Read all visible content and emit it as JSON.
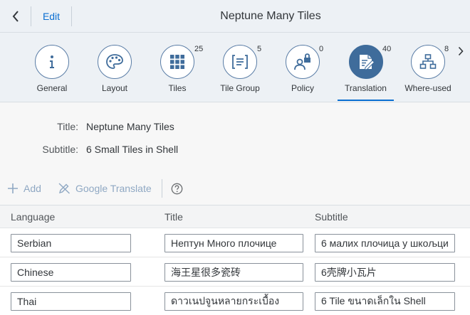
{
  "header": {
    "edit_label": "Edit",
    "title": "Neptune Many Tiles"
  },
  "tabs": [
    {
      "label": "General",
      "count": "",
      "icon": "info-icon"
    },
    {
      "label": "Layout",
      "count": "",
      "icon": "palette-icon"
    },
    {
      "label": "Tiles",
      "count": "25",
      "icon": "grid-icon"
    },
    {
      "label": "Tile Group",
      "count": "5",
      "icon": "tile-group-icon"
    },
    {
      "label": "Policy",
      "count": "0",
      "icon": "user-lock-icon"
    },
    {
      "label": "Translation",
      "count": "40",
      "icon": "translation-icon",
      "selected": true
    },
    {
      "label": "Where-used",
      "count": "8",
      "icon": "hierarchy-icon"
    }
  ],
  "form": {
    "title_label": "Title:",
    "title_value": "Neptune Many Tiles",
    "subtitle_label": "Subtitle:",
    "subtitle_value": "6 Small Tiles in Shell"
  },
  "toolbar": {
    "add_label": "Add",
    "google_translate_label": "Google Translate"
  },
  "table": {
    "columns": [
      "Language",
      "Title",
      "Subtitle"
    ],
    "rows": [
      {
        "language": "Serbian",
        "title": "Нептун Много плочице",
        "subtitle": "6 малих плочица у шкољци"
      },
      {
        "language": "Chinese",
        "title": "海王星很多瓷砖",
        "subtitle": "6壳牌小瓦片"
      },
      {
        "language": "Thai",
        "title": "ดาวเนปจูนหลายกระเบื้อง",
        "subtitle": "6 Tile ขนาดเล็กใน Shell"
      }
    ]
  },
  "colors": {
    "accent": "#0a6ed1",
    "icon_blue": "#3f6c9b",
    "muted": "#8fa8c3"
  }
}
